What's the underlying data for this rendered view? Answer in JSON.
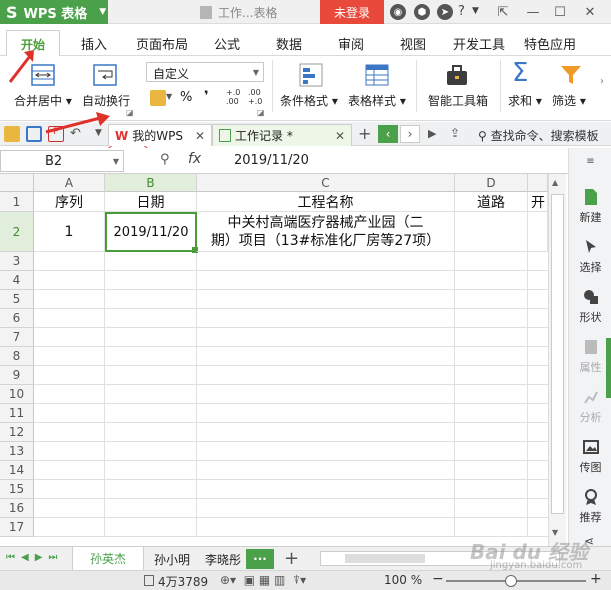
{
  "app": {
    "name": "WPS 表格",
    "doc_title": "工作...表格",
    "login_label": "未登录"
  },
  "tabs": [
    "开始",
    "插入",
    "页面布局",
    "公式",
    "数据",
    "审阅",
    "视图",
    "开发工具",
    "特色应用"
  ],
  "ribbon": {
    "merge_center": "合并居中",
    "auto_wrap": "自动换行",
    "number_format": "自定义",
    "percent": "%",
    "comma": "❜",
    "inc_decimal": "+.0 .00",
    "dec_decimal": ".00 +.0",
    "cond_format": "条件格式",
    "table_style": "表格样式",
    "smart_toolbox": "智能工具箱",
    "sum": "求和",
    "filter": "筛选"
  },
  "quickbar": {
    "mywps_tab": "我的WPS",
    "workbook_tab": "工作记录 *",
    "search": "查找命令、搜索模板"
  },
  "formula": {
    "cell_ref": "B2",
    "fx": "fx",
    "value": "2019/11/20"
  },
  "grid": {
    "columns": [
      "A",
      "B",
      "C",
      "D",
      ""
    ],
    "rows": [
      "1",
      "2",
      "3",
      "4",
      "5",
      "6",
      "7",
      "8",
      "9",
      "10",
      "11",
      "12",
      "13",
      "14",
      "15",
      "16",
      "17"
    ],
    "headers": [
      "序列",
      "日期",
      "工程名称",
      "道路",
      "开"
    ],
    "row2": {
      "a": "1",
      "b": "2019/11/20",
      "c_line1": "中关村高端医疗器械产业园（二",
      "c_line2": "期）项目（13#标准化厂房等27项）"
    }
  },
  "right_panel": [
    "新建",
    "选择",
    "形状",
    "属性",
    "分析",
    "传图",
    "推荐"
  ],
  "sheets": [
    "孙英杰",
    "孙小明",
    "李晓彤"
  ],
  "status": {
    "count": "4万3789",
    "zoom": "100 %"
  },
  "watermark": {
    "text": "Bai du 经验",
    "url": "jingyan.baidu.com"
  },
  "colors": {
    "accent": "#4aa14a",
    "login": "#e8493a",
    "annotation": "#e0302a"
  }
}
